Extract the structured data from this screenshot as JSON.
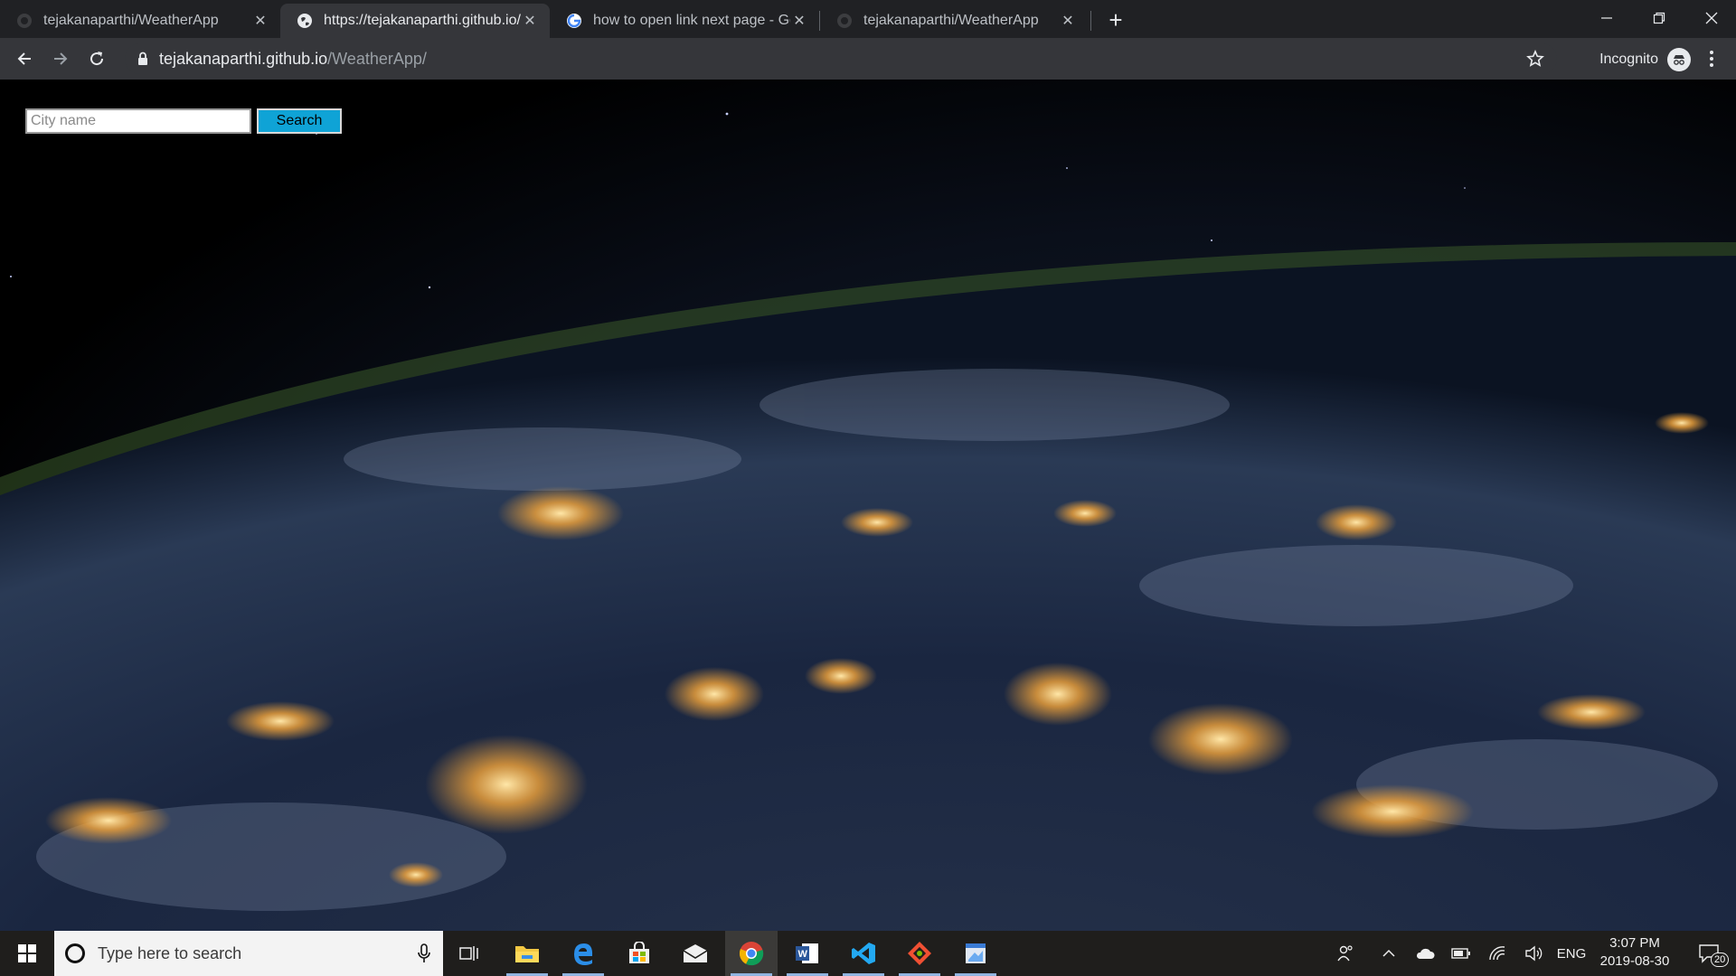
{
  "browser": {
    "tabs": [
      {
        "title": "tejakanaparthi/WeatherApp",
        "favicon": "github-icon",
        "active": false
      },
      {
        "title": "https://tejakanaparthi.github.io/W",
        "favicon": "globe-icon",
        "active": true
      },
      {
        "title": "how to open link next page - Go",
        "favicon": "google-icon",
        "active": false
      },
      {
        "title": "tejakanaparthi/WeatherApp",
        "favicon": "github-icon",
        "active": false
      }
    ],
    "url_host": "tejakanaparthi.github.io",
    "url_path": "/WeatherApp/",
    "incognito_label": "Incognito"
  },
  "page": {
    "city_placeholder": "City name",
    "search_label": "Search",
    "background": "night Earth from orbit with city lights"
  },
  "taskbar": {
    "search_placeholder": "Type here to search",
    "apps": [
      "task-view-icon",
      "file-explorer-icon",
      "edge-icon",
      "store-icon",
      "mail-icon",
      "chrome-icon",
      "word-icon",
      "vscode-icon",
      "git-icon",
      "paint-icon"
    ],
    "language": "ENG",
    "time": "3:07 PM",
    "date": "2019-08-30",
    "notifications": "20"
  },
  "colors": {
    "search_button": "#0fa3d6",
    "tab_strip": "#202124",
    "toolbar": "#35363a",
    "taskbar": "#1f1e1c"
  }
}
